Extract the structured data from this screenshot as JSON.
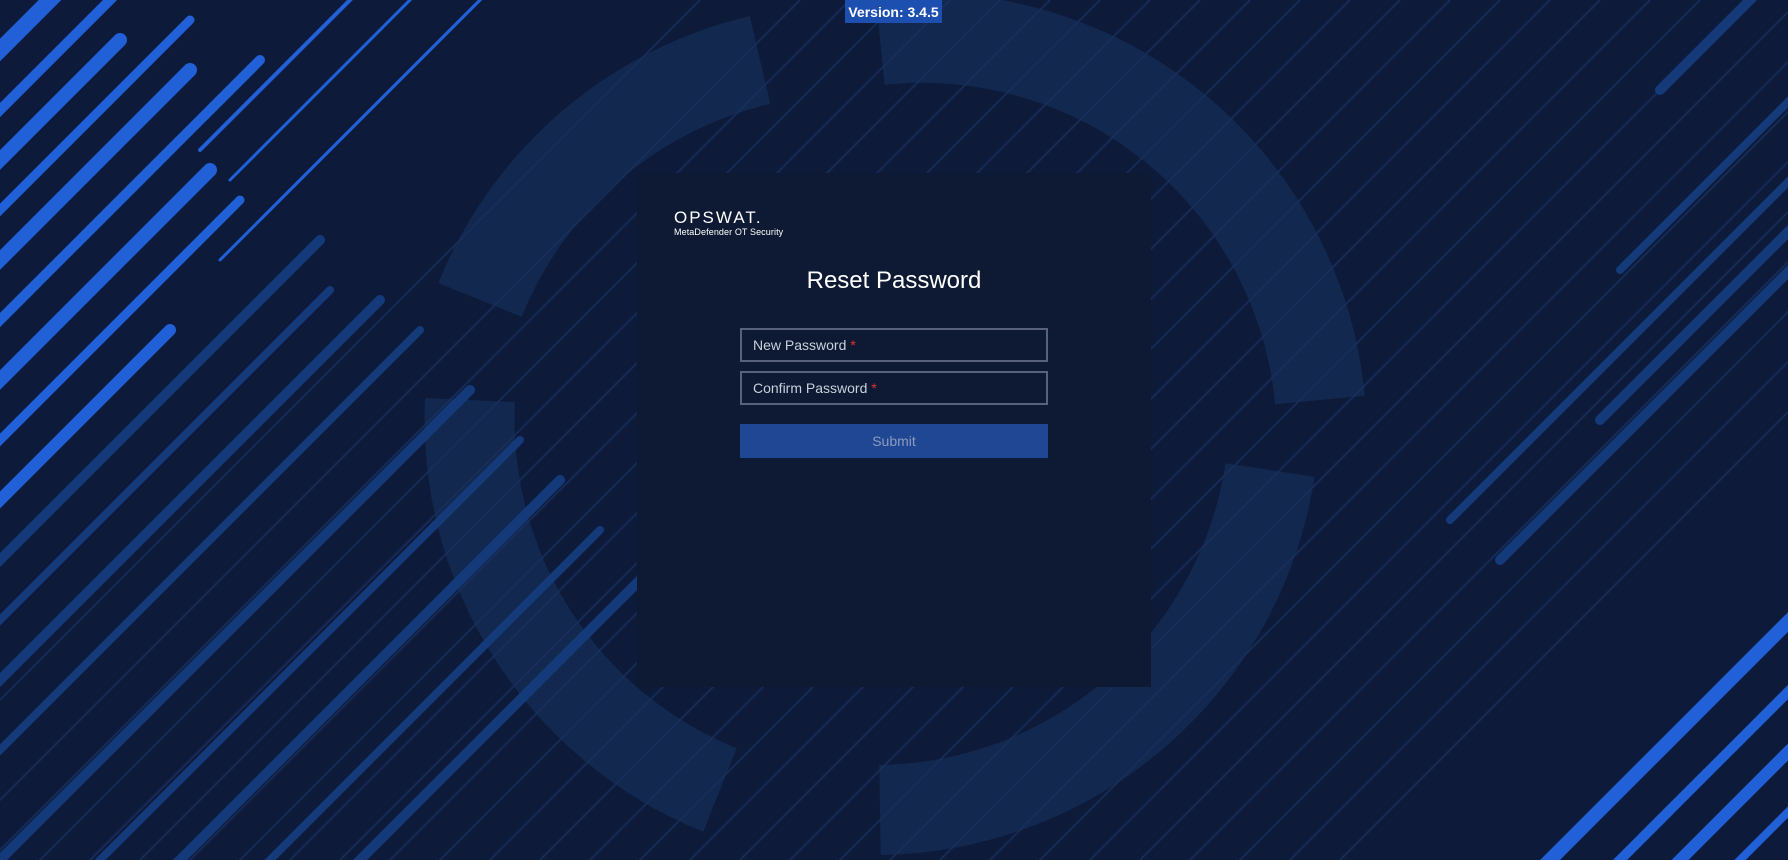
{
  "version": {
    "label": "Version: 3.4.5"
  },
  "brand": {
    "logo_text": "OPSWAT.",
    "product_name": "MetaDefender OT Security"
  },
  "form": {
    "title": "Reset Password",
    "new_password": {
      "label": "New Password",
      "required_mark": "*",
      "value": ""
    },
    "confirm_password": {
      "label": "Confirm Password",
      "required_mark": "*",
      "value": ""
    },
    "submit_label": "Submit"
  },
  "colors": {
    "background": "#0d1a3a",
    "card": "#0e1a33",
    "accent": "#1d4fb0",
    "submit_button": "#1f4793",
    "required": "#e0312f"
  }
}
